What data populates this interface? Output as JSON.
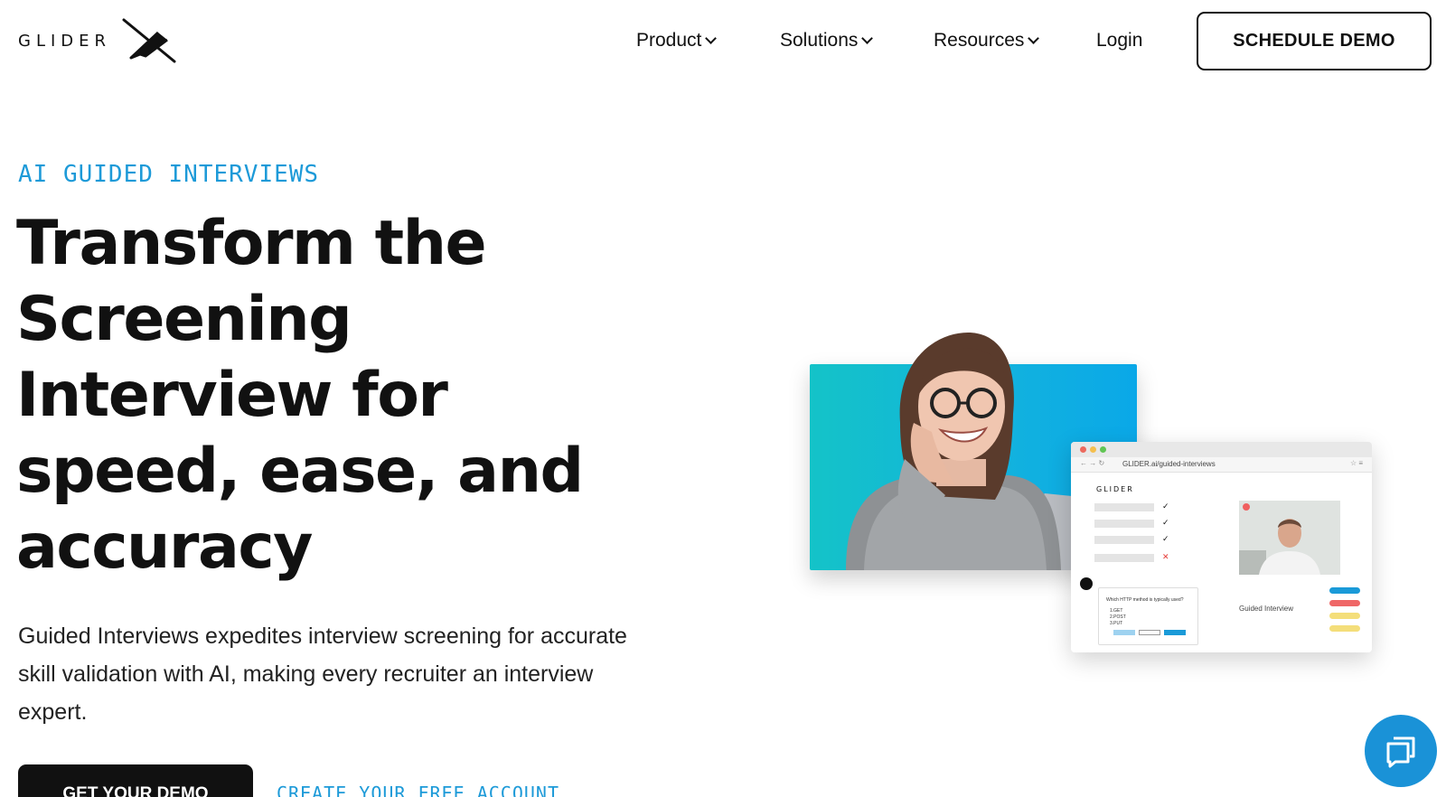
{
  "brand": {
    "name": "GLIDER"
  },
  "nav": {
    "items": [
      {
        "label": "Product",
        "has_dropdown": true
      },
      {
        "label": "Solutions",
        "has_dropdown": true
      },
      {
        "label": "Resources",
        "has_dropdown": true
      }
    ],
    "login_label": "Login",
    "cta_label": "SCHEDULE DEMO"
  },
  "hero": {
    "eyebrow": "AI GUIDED INTERVIEWS",
    "headline_lines": [
      "Transform the",
      "Screening",
      "Interview for",
      "speed, ease, and",
      "accuracy"
    ],
    "lead": "Guided Interviews expedites interview screening for accurate skill validation with AI, making every recruiter an interview expert.",
    "primary_cta": "GET YOUR DEMO",
    "secondary_cta": "CREATE YOUR FREE ACCOUNT"
  },
  "mockup": {
    "url": "GLIDER.ai/guided-interviews",
    "logo_text": "GLIDER",
    "video_caption": "Guided Interview",
    "question": "Which HTTP method is typically used?",
    "options": [
      "1.GET",
      "2.POST",
      "3.PUT"
    ]
  },
  "colors": {
    "accent": "#1d9ad8",
    "primary_button": "#111111",
    "chat_bubble": "#1a92d7"
  },
  "icons": {
    "chat": "chat-bubble-icon",
    "chevron": "chevron-down-icon",
    "logo": "glider-plane-icon"
  }
}
